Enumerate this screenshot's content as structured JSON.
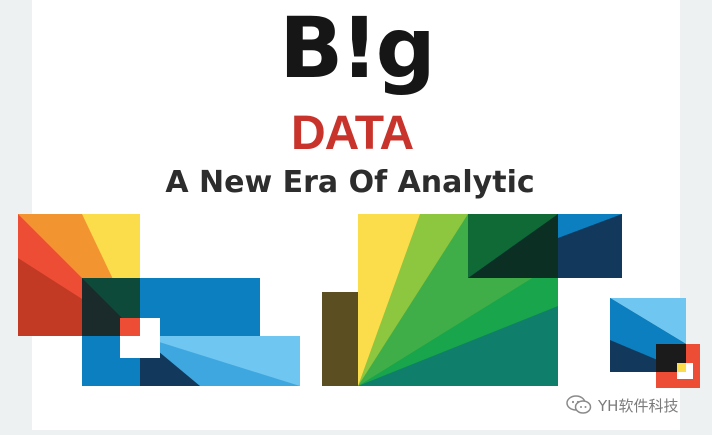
{
  "logo": {
    "big_prefix": "B",
    "big_bang": "!",
    "big_suffix": "g",
    "data_word": "DATA"
  },
  "tagline": "A New Era Of Analytic",
  "watermark": {
    "icon": "wechat-icon",
    "text": "YH软件科技"
  },
  "colors": {
    "logo_dark": "#161616",
    "logo_red": "#c8342c",
    "tagline": "#2d2d2d",
    "red": "#ee4d35",
    "orange": "#f29530",
    "yellow": "#fbdd4c",
    "blue": "#0b7fbf",
    "light_blue": "#6fc6f0",
    "navy": "#12395c",
    "green": "#19a54b",
    "lime": "#8dc63f",
    "teal": "#0f7f6c",
    "olive": "#5b4e20"
  }
}
